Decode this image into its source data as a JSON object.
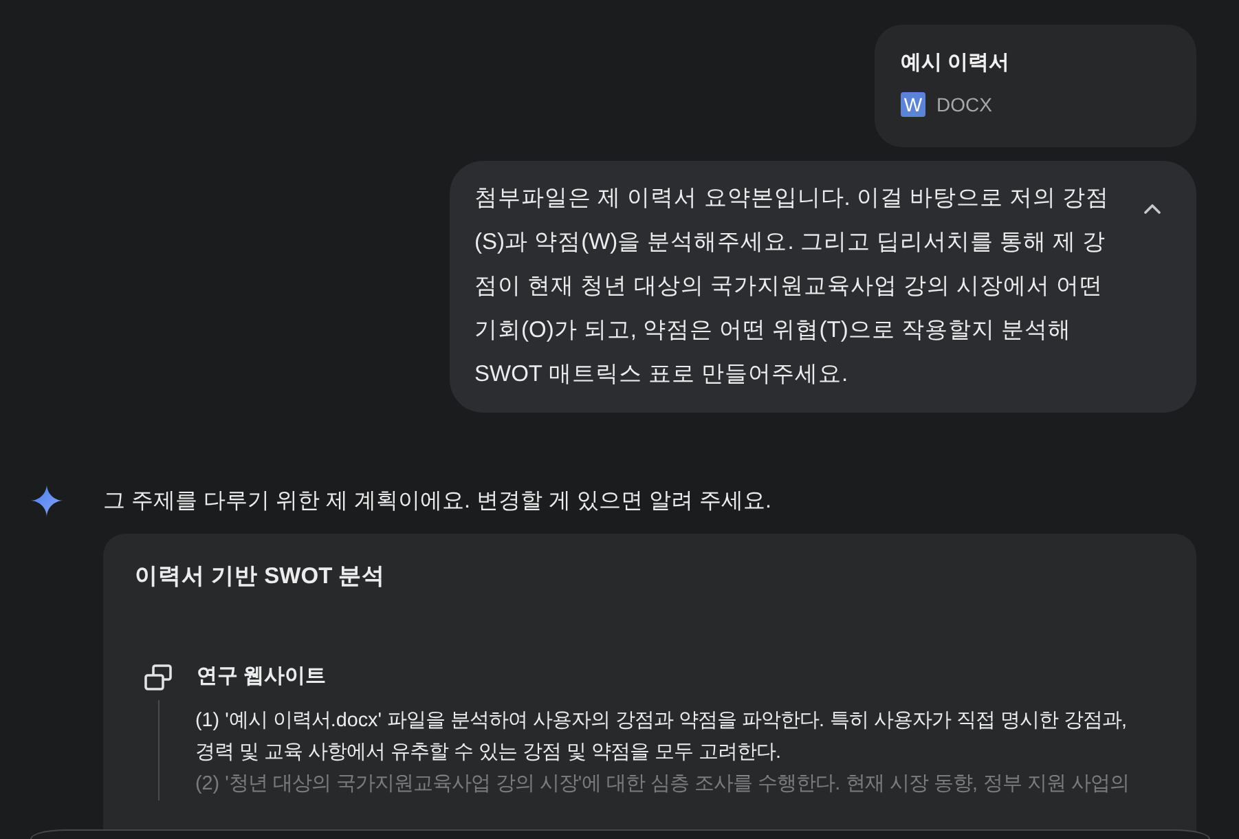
{
  "attachment": {
    "name": "예시 이력서",
    "type_badge": "W",
    "file_type": "DOCX"
  },
  "user_message": {
    "text": "첨부파일은 제 이력서 요약본입니다. 이걸 바탕으로 저의 강점 (S)과 약점(W)을 분석해주세요. 그리고 딥리서치를 통해 제 강점이 현재 청년 대상의 국가지원교육사업 강의 시장에서 어떤 기회(O)가 되고, 약점은 어떤 위협(T)으로 작용할지 분석해 SWOT 매트릭스 표로 만들어주세요.",
    "expanded": true
  },
  "response": {
    "text": "그 주제를 다루기 위한 제 계획이에요. 변경할 게 있으면 알려 주세요."
  },
  "plan": {
    "title": "이력서 기반 SWOT 분석",
    "section": "연구 웹사이트",
    "steps": [
      "(1) '예시 이력서.docx' 파일을 분석하여 사용자의 강점과 약점을 파악한다. 특히 사용자가 직접 명시한 강점과, 경력 및 교육 사항에서 유추할 수 있는 강점 및 약점을 모두 고려한다.",
      "(2) '청년 대상의 국가지원교육사업 강의 시장'에 대한 심층 조사를 수행한다. 현재 시장 동향, 정부 지원 사업의"
    ]
  }
}
